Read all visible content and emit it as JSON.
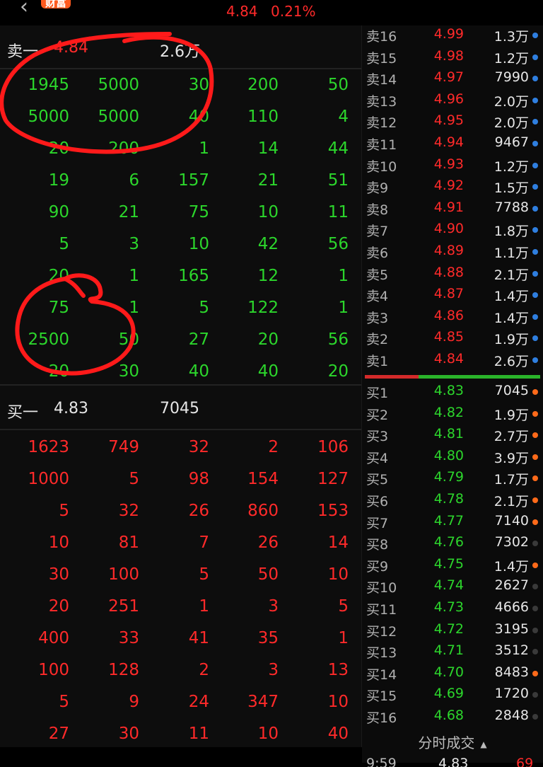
{
  "header": {
    "back_icon": "chevron-left-icon",
    "badge": "财富",
    "price": "4.84",
    "change_pct": "0.21%"
  },
  "sell_summary": {
    "label": "卖一",
    "price": "4.84",
    "volume": "2.6万"
  },
  "sell_grid": [
    [
      "1945",
      "5000",
      "30",
      "200",
      "50"
    ],
    [
      "5000",
      "5000",
      "40",
      "110",
      "4"
    ],
    [
      "20",
      "200",
      "1",
      "14",
      "44"
    ],
    [
      "19",
      "6",
      "157",
      "21",
      "51"
    ],
    [
      "90",
      "21",
      "75",
      "10",
      "11"
    ],
    [
      "5",
      "3",
      "10",
      "42",
      "56"
    ],
    [
      "20",
      "1",
      "165",
      "12",
      "1"
    ],
    [
      "75",
      "1",
      "5",
      "122",
      "1"
    ],
    [
      "2500",
      "50",
      "27",
      "20",
      "56"
    ],
    [
      "20",
      "30",
      "40",
      "40",
      "20"
    ]
  ],
  "buy_summary": {
    "label": "买一",
    "price": "4.83",
    "volume": "7045"
  },
  "buy_grid": [
    [
      "1623",
      "749",
      "32",
      "2",
      "106"
    ],
    [
      "1000",
      "5",
      "98",
      "154",
      "127"
    ],
    [
      "5",
      "32",
      "26",
      "860",
      "153"
    ],
    [
      "10",
      "81",
      "7",
      "26",
      "14"
    ],
    [
      "30",
      "100",
      "5",
      "50",
      "10"
    ],
    [
      "20",
      "251",
      "1",
      "3",
      "5"
    ],
    [
      "400",
      "33",
      "41",
      "35",
      "1"
    ],
    [
      "100",
      "128",
      "2",
      "3",
      "13"
    ],
    [
      "5",
      "9",
      "24",
      "347",
      "10"
    ],
    [
      "27",
      "30",
      "11",
      "10",
      "40"
    ]
  ],
  "asks": [
    {
      "label": "卖16",
      "price": "4.99",
      "vol": "1.3万",
      "dot": "#2f7fe0"
    },
    {
      "label": "卖15",
      "price": "4.98",
      "vol": "1.2万",
      "dot": "#2f7fe0"
    },
    {
      "label": "卖14",
      "price": "4.97",
      "vol": "7990",
      "dot": "#2f7fe0"
    },
    {
      "label": "卖13",
      "price": "4.96",
      "vol": "2.0万",
      "dot": "#2f7fe0"
    },
    {
      "label": "卖12",
      "price": "4.95",
      "vol": "2.0万",
      "dot": "#2f7fe0"
    },
    {
      "label": "卖11",
      "price": "4.94",
      "vol": "9467",
      "dot": "#2f7fe0"
    },
    {
      "label": "卖10",
      "price": "4.93",
      "vol": "1.2万",
      "dot": "#2f7fe0"
    },
    {
      "label": "卖9",
      "price": "4.92",
      "vol": "1.5万",
      "dot": "#2f7fe0"
    },
    {
      "label": "卖8",
      "price": "4.91",
      "vol": "7788",
      "dot": "#2f7fe0"
    },
    {
      "label": "卖7",
      "price": "4.90",
      "vol": "1.8万",
      "dot": "#2f7fe0"
    },
    {
      "label": "卖6",
      "price": "4.89",
      "vol": "1.1万",
      "dot": "#2f7fe0"
    },
    {
      "label": "卖5",
      "price": "4.88",
      "vol": "2.1万",
      "dot": "#2f7fe0"
    },
    {
      "label": "卖4",
      "price": "4.87",
      "vol": "1.4万",
      "dot": "#2f7fe0"
    },
    {
      "label": "卖3",
      "price": "4.86",
      "vol": "1.4万",
      "dot": "#2f7fe0"
    },
    {
      "label": "卖2",
      "price": "4.85",
      "vol": "1.9万",
      "dot": "#2f7fe0"
    },
    {
      "label": "卖1",
      "price": "4.84",
      "vol": "2.6万",
      "dot": "#2f7fe0"
    }
  ],
  "bids": [
    {
      "label": "买1",
      "price": "4.83",
      "vol": "7045",
      "dot": "#ff6a1a"
    },
    {
      "label": "买2",
      "price": "4.82",
      "vol": "1.9万",
      "dot": "#ff6a1a"
    },
    {
      "label": "买3",
      "price": "4.81",
      "vol": "2.7万",
      "dot": "#ff6a1a"
    },
    {
      "label": "买4",
      "price": "4.80",
      "vol": "3.9万",
      "dot": "#ff6a1a"
    },
    {
      "label": "买5",
      "price": "4.79",
      "vol": "1.7万",
      "dot": "#ff6a1a"
    },
    {
      "label": "买6",
      "price": "4.78",
      "vol": "2.1万",
      "dot": "#ff6a1a"
    },
    {
      "label": "买7",
      "price": "4.77",
      "vol": "7140",
      "dot": "#ff6a1a"
    },
    {
      "label": "买8",
      "price": "4.76",
      "vol": "7302",
      "dot": "#3a3a3a"
    },
    {
      "label": "买9",
      "price": "4.75",
      "vol": "1.4万",
      "dot": "#ff6a1a"
    },
    {
      "label": "买10",
      "price": "4.74",
      "vol": "2627",
      "dot": "#3a3a3a"
    },
    {
      "label": "买11",
      "price": "4.73",
      "vol": "4666",
      "dot": "#3a3a3a"
    },
    {
      "label": "买12",
      "price": "4.72",
      "vol": "3195",
      "dot": "#3a3a3a"
    },
    {
      "label": "买13",
      "price": "4.71",
      "vol": "3512",
      "dot": "#3a3a3a"
    },
    {
      "label": "买14",
      "price": "4.70",
      "vol": "8483",
      "dot": "#ff6a1a"
    },
    {
      "label": "买15",
      "price": "4.69",
      "vol": "1720",
      "dot": "#3a3a3a"
    },
    {
      "label": "买16",
      "price": "4.68",
      "vol": "2848",
      "dot": "#3a3a3a"
    }
  ],
  "fenshi": {
    "label": "分时成交",
    "icon": "triangle-up-icon"
  },
  "last_trade": {
    "time": "9:59",
    "price": "4.83",
    "vol": "69"
  },
  "colors": {
    "up": "#ff2a2a",
    "down": "#2cd62c",
    "annotation": "#ff1a1a"
  }
}
